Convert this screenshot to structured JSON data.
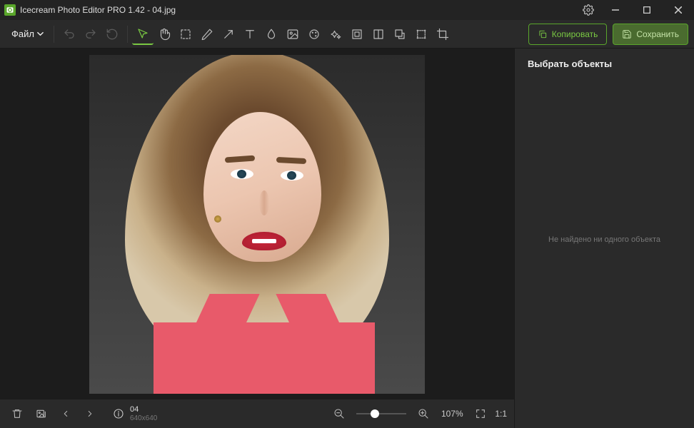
{
  "window": {
    "title": "Icecream Photo Editor PRO 1.42 - 04.jpg"
  },
  "menu": {
    "file": "Файл"
  },
  "actions": {
    "copy": "Копировать",
    "save": "Сохранить"
  },
  "sidebar": {
    "title": "Выбрать объекты",
    "empty": "Не найдено ни одного объекта"
  },
  "status": {
    "filename": "04",
    "dimensions": "640x640",
    "zoom": "107%",
    "ratio": "1:1"
  }
}
